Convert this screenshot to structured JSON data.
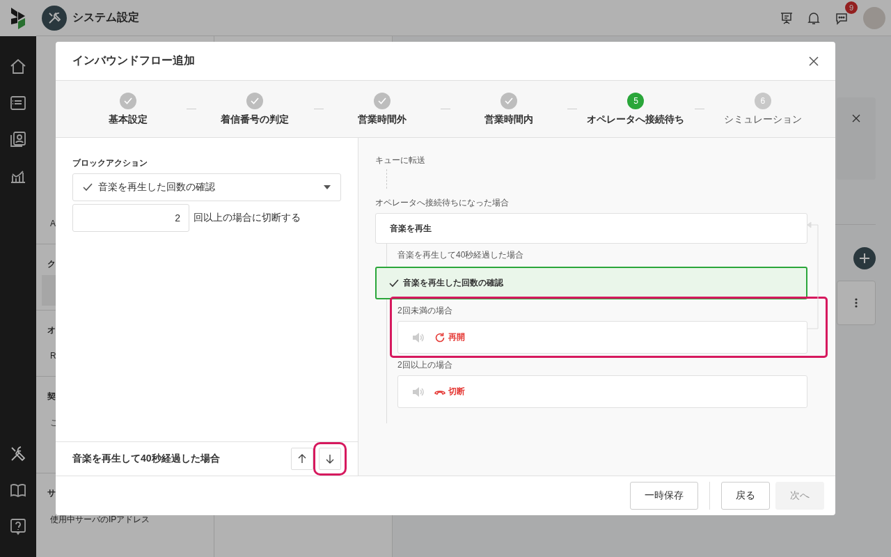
{
  "header": {
    "title": "システム設定",
    "notification_badge": "9"
  },
  "background_sidebar": {
    "items": [
      {
        "kind": "item",
        "selected": false
      },
      {
        "kind": "item",
        "selected": false
      },
      {
        "kind": "item",
        "selected": false
      },
      {
        "kind": "item",
        "selected": false
      },
      {
        "kind": "item",
        "selected": false
      },
      {
        "kind": "item",
        "selected": false
      },
      {
        "kind": "item",
        "label": "A",
        "selected": false
      },
      {
        "kind": "heading",
        "label": "ク"
      },
      {
        "kind": "item",
        "selected": true
      },
      {
        "kind": "heading",
        "label": "オ"
      },
      {
        "kind": "item",
        "label": "R",
        "selected": false
      },
      {
        "kind": "heading",
        "label": "契"
      },
      {
        "kind": "item",
        "label": "こ",
        "selected": false
      },
      {
        "kind": "item",
        "selected": false
      },
      {
        "kind": "heading",
        "label": "サ"
      },
      {
        "kind": "item",
        "label": "使用中サーバのIPアドレス",
        "selected": false
      }
    ]
  },
  "modal": {
    "title": "インバウンドフロー追加",
    "steps": [
      {
        "label": "基本設定",
        "done": true,
        "current": false
      },
      {
        "label": "着信番号の判定",
        "done": true,
        "current": false
      },
      {
        "label": "営業時間外",
        "done": true,
        "current": false
      },
      {
        "label": "営業時間内",
        "done": true,
        "current": false
      },
      {
        "label": "オペレータへ接続待ち",
        "done": false,
        "current": true,
        "number": "5"
      },
      {
        "label": "シミュレーション",
        "done": false,
        "current": false,
        "number": "6"
      }
    ],
    "block_action": {
      "label": "ブロックアクション",
      "value": "音楽を再生した回数の確認"
    },
    "count_field": {
      "value": "2",
      "suffix": "回以上の場合に切断する"
    },
    "condition_bar": {
      "label": "音楽を再生して40秒経過した場合",
      "buttons": [
        {
          "kind": "up",
          "highlighted": false
        },
        {
          "kind": "down",
          "highlighted": true
        }
      ]
    },
    "flow": {
      "source": "キューに転送",
      "trigger": "オペレータへ接続待ちになった場合",
      "first_block": "音楽を再生",
      "first_condition": "音楽を再生して40秒経過した場合",
      "selected_block": "音楽を再生した回数の確認",
      "branches": [
        {
          "condition": "2回未満の場合",
          "kind": "restart",
          "action": "再開",
          "highlighted": true
        },
        {
          "condition": "2回以上の場合",
          "kind": "hangup",
          "action": "切断",
          "highlighted": false
        }
      ]
    },
    "footer": {
      "buttons": [
        {
          "label": "一時保存",
          "disabled": false
        },
        {
          "label": "戻る",
          "disabled": false
        },
        {
          "label": "次へ",
          "disabled": true
        }
      ]
    }
  }
}
